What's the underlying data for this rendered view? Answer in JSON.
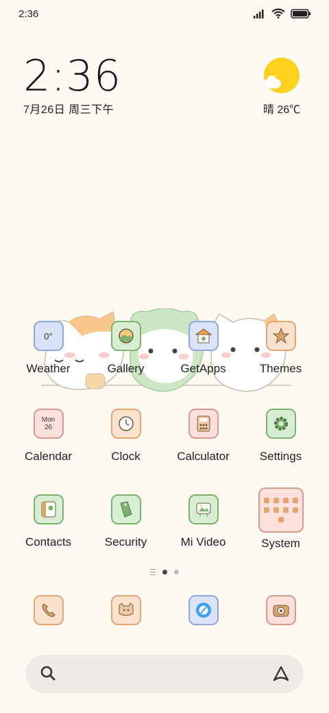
{
  "status_bar": {
    "time": "2:36"
  },
  "clock_widget": {
    "time": "2:36",
    "date": "7月26日 周三下午"
  },
  "weather_widget": {
    "text": "晴 26℃",
    "icon": "sunny-cloud-icon"
  },
  "apps": [
    {
      "label": "Weather",
      "icon": "weather-icon",
      "tile_color": "#d8e3f8",
      "border": "#8fa6d8",
      "glyph": "0°"
    },
    {
      "label": "Gallery",
      "icon": "gallery-icon",
      "tile_color": "#d8eed3",
      "border": "#7eb06f",
      "glyph": ""
    },
    {
      "label": "GetApps",
      "icon": "getapps-icon",
      "tile_color": "#dbe3f8",
      "border": "#8fa6d8",
      "glyph": ""
    },
    {
      "label": "Themes",
      "icon": "themes-icon",
      "tile_color": "#fbe2cf",
      "border": "#e6a46f",
      "glyph": ""
    },
    {
      "label": "Calendar",
      "icon": "calendar-icon",
      "tile_color": "#fbe0db",
      "border": "#d89a90",
      "glyph": "Mon 26"
    },
    {
      "label": "Clock",
      "icon": "clock-icon",
      "tile_color": "#fbe2cf",
      "border": "#e6a46f",
      "glyph": ""
    },
    {
      "label": "Calculator",
      "icon": "calculator-icon",
      "tile_color": "#fbe0db",
      "border": "#d89a90",
      "glyph": ""
    },
    {
      "label": "Settings",
      "icon": "settings-icon",
      "tile_color": "#d8eed3",
      "border": "#7eb06f",
      "glyph": ""
    },
    {
      "label": "Contacts",
      "icon": "contacts-icon",
      "tile_color": "#d8eed3",
      "border": "#7eb06f",
      "glyph": ""
    },
    {
      "label": "Security",
      "icon": "security-icon",
      "tile_color": "#d8eed3",
      "border": "#7eb06f",
      "glyph": ""
    },
    {
      "label": "Mi Video",
      "icon": "mi-video-icon",
      "tile_color": "#d8eed3",
      "border": "#7eb06f",
      "glyph": ""
    },
    {
      "label": "System",
      "icon": "system-folder-icon",
      "tile_color": "#fbe0db",
      "border": "#d89a90",
      "glyph": ""
    }
  ],
  "dock": [
    {
      "icon": "phone-icon",
      "tile_color": "#fbe2cf",
      "border": "#e6a46f"
    },
    {
      "icon": "messages-icon",
      "tile_color": "#fbe2cf",
      "border": "#e6a46f"
    },
    {
      "icon": "browser-icon",
      "tile_color": "#dbe3f8",
      "border": "#8fa6d8"
    },
    {
      "icon": "camera-icon",
      "tile_color": "#fbe0db",
      "border": "#d89a90"
    }
  ],
  "page_indicator": {
    "pages": 2,
    "current": 1
  }
}
